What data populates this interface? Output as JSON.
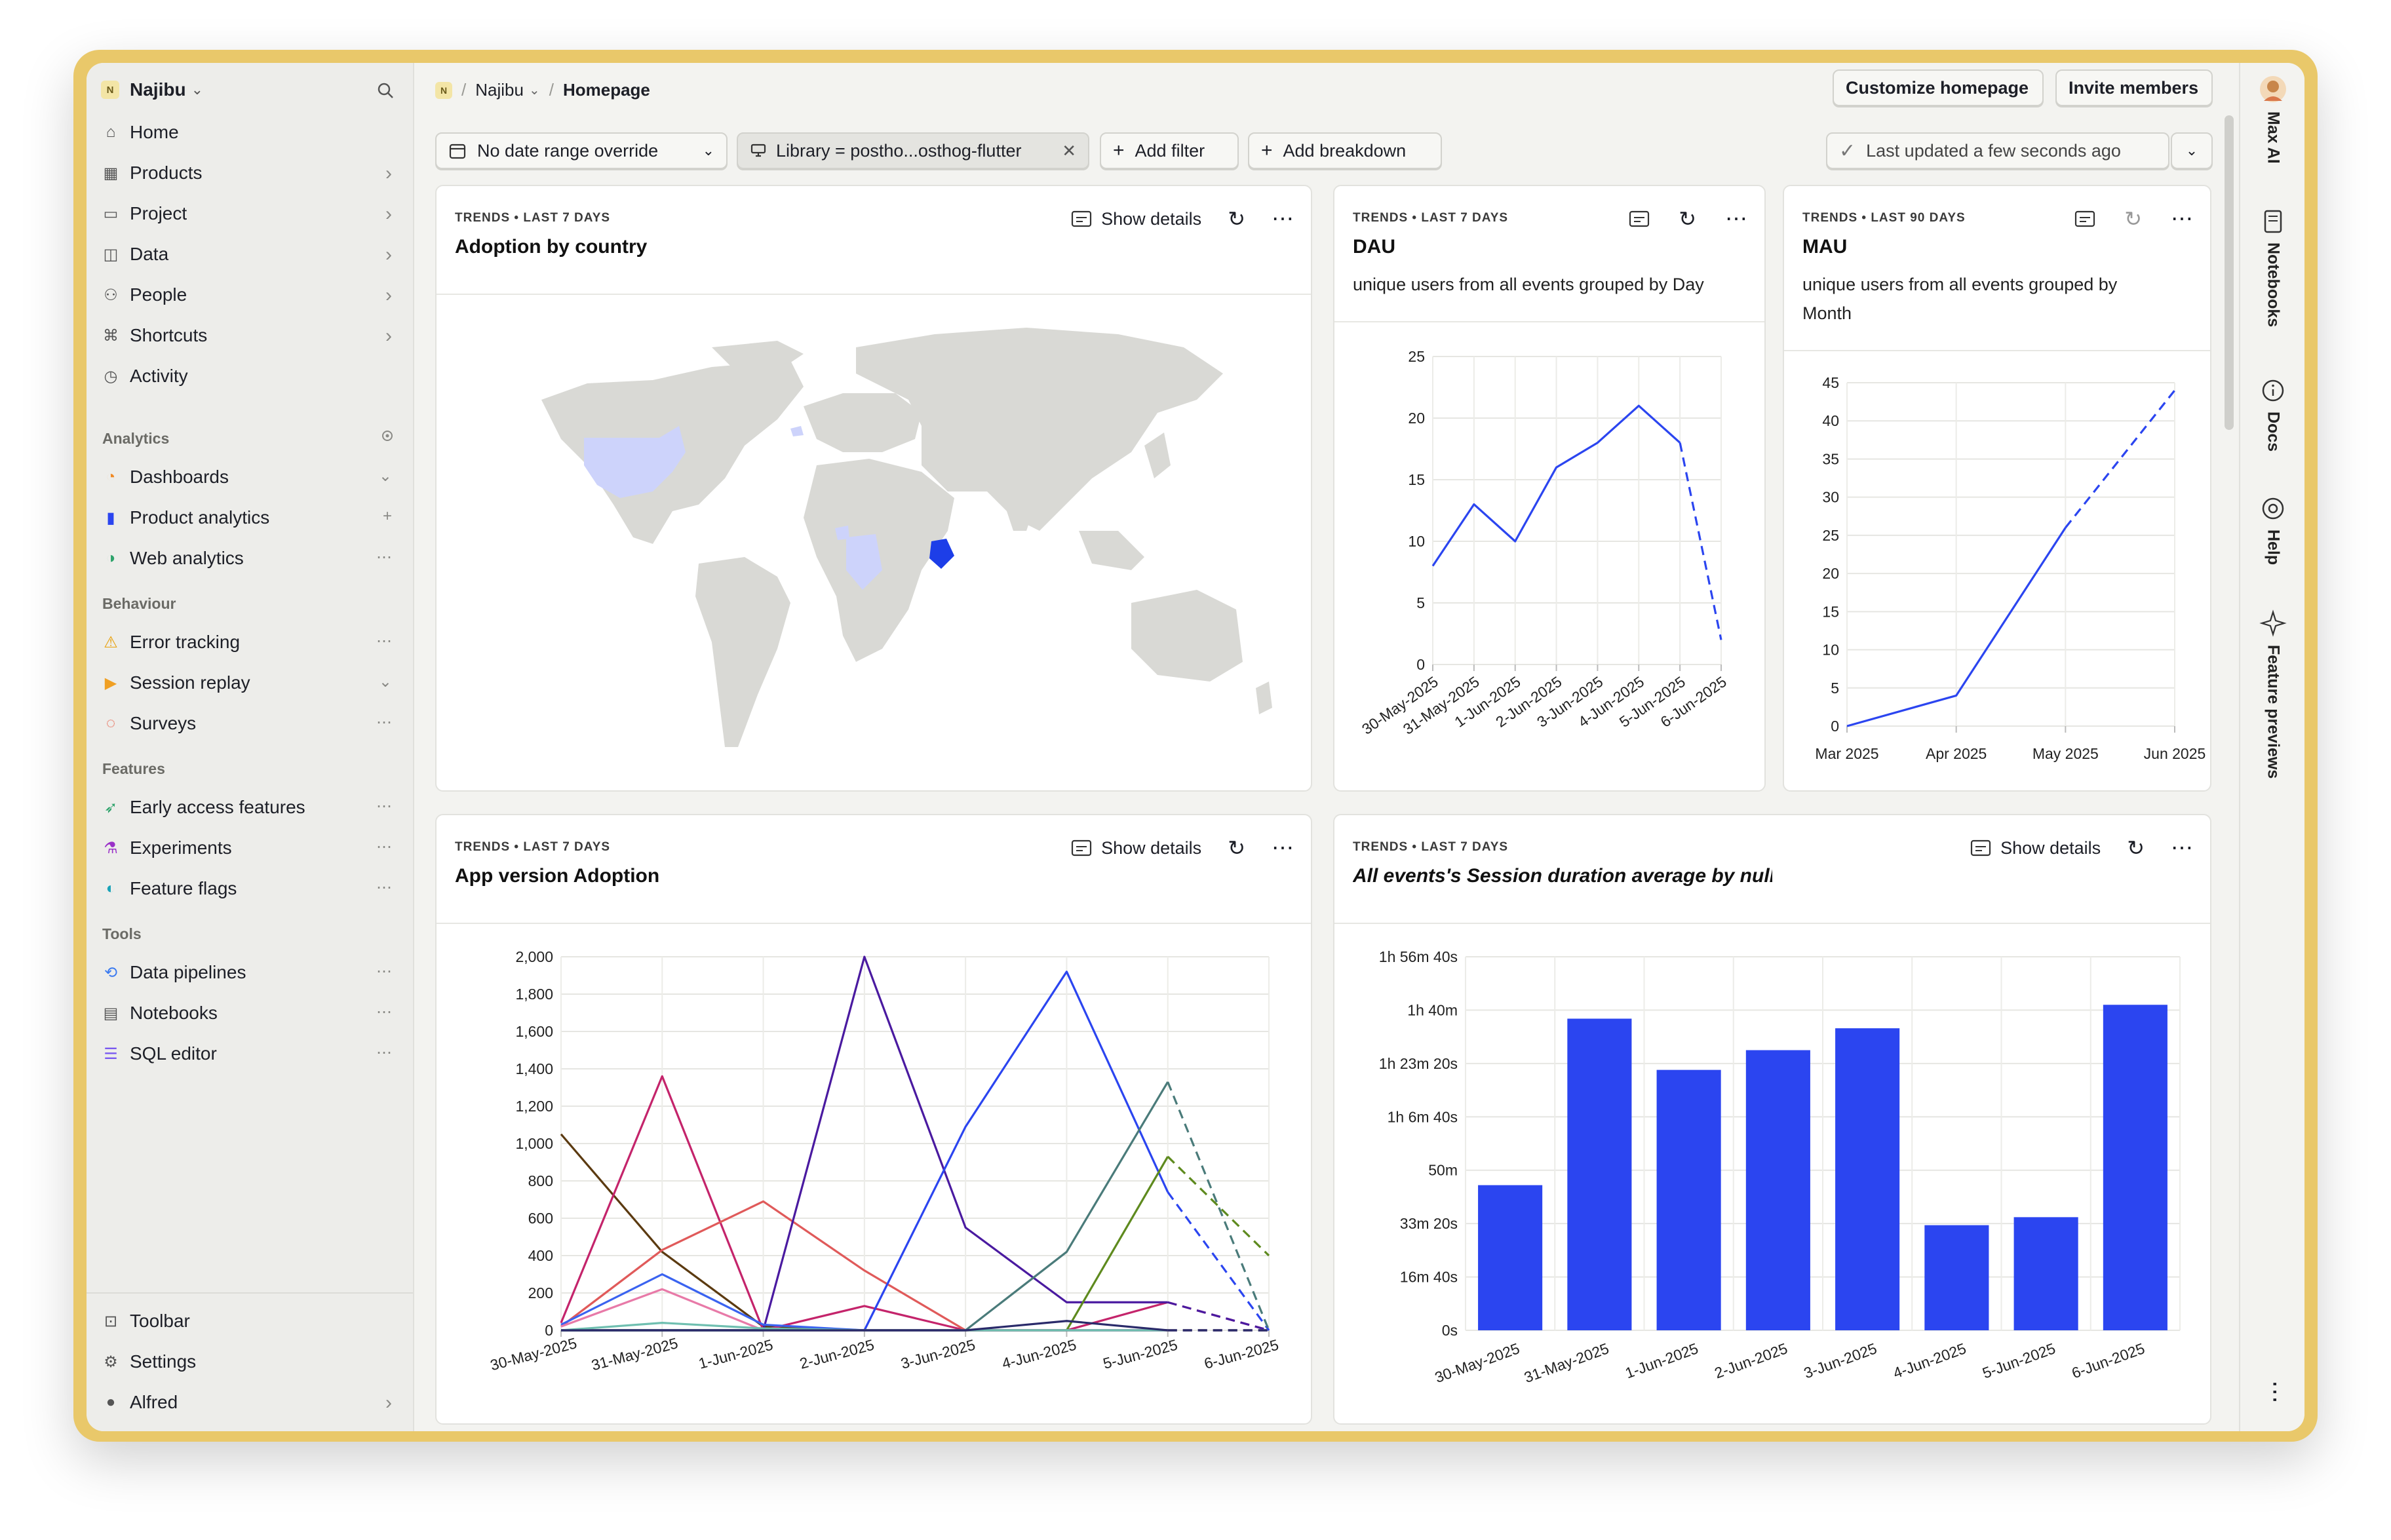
{
  "workspace": {
    "badge": "N",
    "name": "Najibu"
  },
  "nav_top": [
    {
      "label": "Home",
      "icon": "home-icon",
      "chevron": false
    },
    {
      "label": "Products",
      "icon": "products-icon",
      "chevron": true
    },
    {
      "label": "Project",
      "icon": "folder-icon",
      "chevron": true
    },
    {
      "label": "Data",
      "icon": "database-icon",
      "chevron": true
    },
    {
      "label": "People",
      "icon": "people-icon",
      "chevron": true
    },
    {
      "label": "Shortcuts",
      "icon": "shortcut-icon",
      "chevron": true
    },
    {
      "label": "Activity",
      "icon": "clock-icon",
      "chevron": false
    }
  ],
  "sections": {
    "analytics": "Analytics",
    "behaviour": "Behaviour",
    "features": "Features",
    "tools": "Tools"
  },
  "analytics_items": [
    {
      "label": "Dashboards",
      "icon": "dashboard-icon",
      "trail": "⌄"
    },
    {
      "label": "Product analytics",
      "icon": "bar-chart-icon",
      "trail": "+"
    },
    {
      "label": "Web analytics",
      "icon": "web-analytics-icon",
      "trail": "⋯"
    }
  ],
  "behaviour_items": [
    {
      "label": "Error tracking",
      "icon": "warning-icon",
      "trail": "⋯"
    },
    {
      "label": "Session replay",
      "icon": "play-icon",
      "trail": "⌄"
    },
    {
      "label": "Surveys",
      "icon": "chat-icon",
      "trail": "⋯"
    }
  ],
  "features_items": [
    {
      "label": "Early access features",
      "icon": "rocket-icon",
      "trail": "⋯"
    },
    {
      "label": "Experiments",
      "icon": "flask-icon",
      "trail": "⋯"
    },
    {
      "label": "Feature flags",
      "icon": "toggle-icon",
      "trail": "⋯"
    }
  ],
  "tools_items": [
    {
      "label": "Data pipelines",
      "icon": "pipeline-icon",
      "trail": "⋯"
    },
    {
      "label": "Notebooks",
      "icon": "notebook-icon",
      "trail": "⋯"
    },
    {
      "label": "SQL editor",
      "icon": "sql-icon",
      "trail": "⋯"
    }
  ],
  "bottom_items": [
    {
      "label": "Toolbar",
      "icon": "toolbar-icon"
    },
    {
      "label": "Settings",
      "icon": "gear-icon"
    },
    {
      "label": "Alfred",
      "icon": "avatar-icon"
    }
  ],
  "breadcrumb": {
    "badge": "N",
    "project": "Najibu",
    "page": "Homepage"
  },
  "header_buttons": {
    "customize": "Customize homepage",
    "invite": "Invite members"
  },
  "filters": {
    "date": "No date range override",
    "library": "Library = postho...osthog-flutter",
    "add_filter": "Add filter",
    "add_breakdown": "Add breakdown",
    "updated": "Last updated a few seconds ago"
  },
  "right_bar": [
    "Max AI",
    "Notebooks",
    "Docs",
    "Help",
    "Feature previews"
  ],
  "common": {
    "show_details": "Show details"
  },
  "cards": {
    "adoption_country": {
      "kicker": "TRENDS • LAST 7 DAYS",
      "title": "Adoption by country"
    },
    "dau": {
      "kicker": "TRENDS • LAST 7 DAYS",
      "title": "DAU",
      "desc": "unique users from all events grouped by Day"
    },
    "mau": {
      "kicker": "TRENDS • LAST 90 DAYS",
      "title": "MAU",
      "desc": "unique users from all events grouped by Month"
    },
    "app_version": {
      "kicker": "TRENDS • LAST 7 DAYS",
      "title": "App version Adoption"
    },
    "session": {
      "kicker": "TRENDS • LAST 7 DAYS",
      "title": "All events's Session duration average by null"
    }
  },
  "colors": {
    "accent": "#2b45f0",
    "map_land": "#d9d9d5",
    "map_light": "#cdd3fb",
    "map_dark": "#1d3ee8"
  },
  "chart_data": [
    {
      "type": "line",
      "id": "dau",
      "categories": [
        "30-May-2025",
        "31-May-2025",
        "1-Jun-2025",
        "2-Jun-2025",
        "3-Jun-2025",
        "4-Jun-2025",
        "5-Jun-2025",
        "6-Jun-2025"
      ],
      "series": [
        {
          "values": [
            8,
            13,
            10,
            16,
            18,
            21,
            18,
            2
          ]
        }
      ],
      "incomplete_last_segment": true,
      "ylim": [
        0,
        25
      ],
      "yticks": [
        "0",
        "5",
        "10",
        "15",
        "20",
        "25"
      ]
    },
    {
      "type": "line",
      "id": "mau",
      "categories": [
        "Mar 2025",
        "Apr 2025",
        "May 2025",
        "Jun 2025"
      ],
      "series": [
        {
          "values": [
            0,
            4,
            26,
            44
          ]
        }
      ],
      "incomplete_last_segment": true,
      "ylim": [
        0,
        45
      ],
      "yticks": [
        "0",
        "5",
        "10",
        "15",
        "20",
        "25",
        "30",
        "35",
        "40",
        "45"
      ]
    },
    {
      "type": "line",
      "id": "app_version",
      "categories": [
        "30-May-2025",
        "31-May-2025",
        "1-Jun-2025",
        "2-Jun-2025",
        "3-Jun-2025",
        "4-Jun-2025",
        "5-Jun-2025",
        "6-Jun-2025"
      ],
      "series": [
        {
          "color": "#5b3a10",
          "values": [
            1050,
            420,
            20,
            0,
            0,
            0,
            0,
            0
          ]
        },
        {
          "color": "#c4246b",
          "values": [
            40,
            1360,
            0,
            130,
            0,
            0,
            150,
            0
          ]
        },
        {
          "color": "#e05a5a",
          "values": [
            20,
            430,
            690,
            320,
            0,
            0,
            0,
            0
          ]
        },
        {
          "color": "#4a1aa0",
          "values": [
            0,
            0,
            0,
            2000,
            550,
            150,
            150,
            0
          ]
        },
        {
          "color": "#2b45f0",
          "values": [
            0,
            0,
            0,
            0,
            1090,
            1920,
            740,
            0
          ]
        },
        {
          "color": "#4a7b7a",
          "values": [
            0,
            0,
            0,
            0,
            0,
            420,
            1330,
            0
          ]
        },
        {
          "color": "#5e8a1e",
          "values": [
            0,
            0,
            0,
            0,
            0,
            0,
            930,
            400
          ]
        },
        {
          "color": "#3a63f0",
          "values": [
            30,
            300,
            30,
            0,
            0,
            0,
            0,
            0
          ]
        },
        {
          "color": "#e87aa8",
          "values": [
            20,
            220,
            0,
            0,
            0,
            0,
            0,
            0
          ]
        },
        {
          "color": "#6fbfb0",
          "values": [
            0,
            40,
            10,
            0,
            0,
            0,
            0,
            0
          ]
        },
        {
          "color": "#2a2a6a",
          "values": [
            0,
            0,
            0,
            0,
            0,
            50,
            0,
            0
          ]
        }
      ],
      "incomplete_last_segment": true,
      "ylim": [
        0,
        2000
      ],
      "yticks": [
        "0",
        "200",
        "400",
        "600",
        "800",
        "1,000",
        "1,200",
        "1,400",
        "1,600",
        "1,800",
        "2,000"
      ]
    },
    {
      "type": "bar",
      "id": "session",
      "categories": [
        "30-May-2025",
        "31-May-2025",
        "1-Jun-2025",
        "2-Jun-2025",
        "3-Jun-2025",
        "4-Jun-2025",
        "5-Jun-2025",
        "6-Jun-2025"
      ],
      "series": [
        {
          "values": [
            2720,
            5840,
            4880,
            5250,
            5660,
            1970,
            2120,
            6100
          ]
        }
      ],
      "unit": "seconds",
      "ylim": [
        0,
        7000
      ],
      "yticks": [
        "0s",
        "16m 40s",
        "33m 20s",
        "50m",
        "1h 6m 40s",
        "1h 23m 20s",
        "1h 40m",
        "1h 56m 40s"
      ]
    }
  ]
}
